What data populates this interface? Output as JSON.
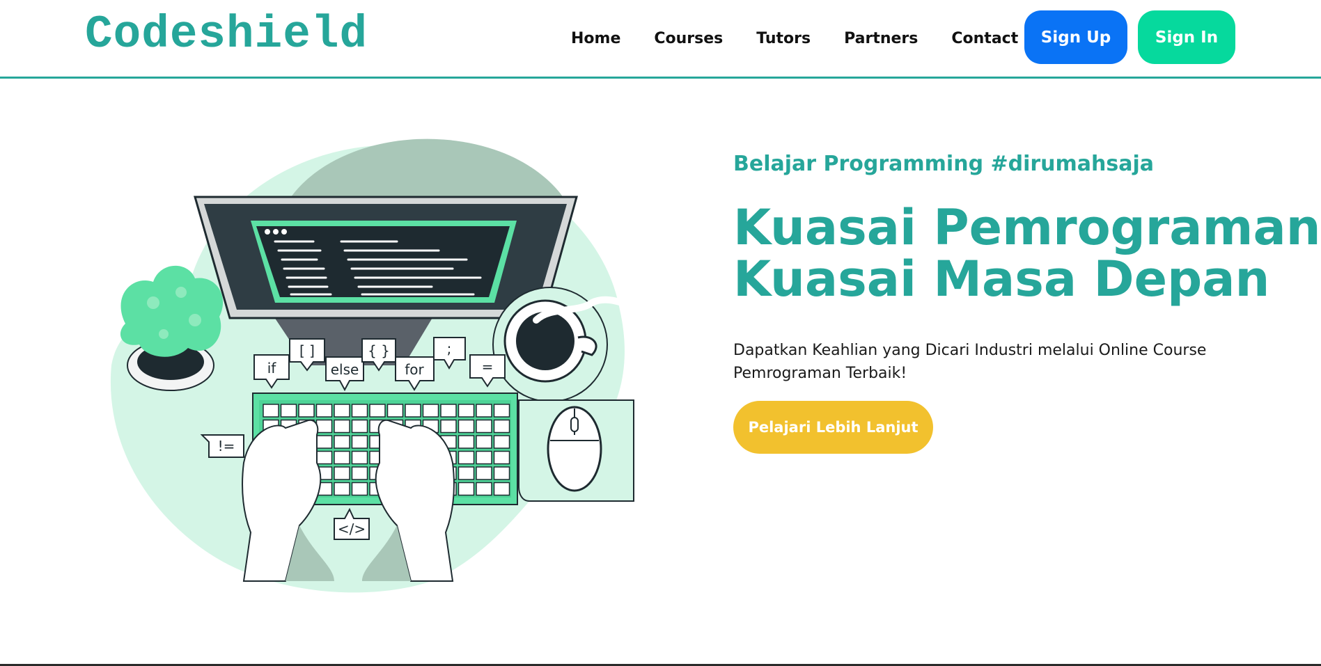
{
  "header": {
    "logo": "Codeshield",
    "nav": [
      "Home",
      "Courses",
      "Tutors",
      "Partners",
      "Contact"
    ],
    "signup_label": "Sign Up",
    "signin_label": "Sign In"
  },
  "hero": {
    "tagline": "Belajar Programming #dirumahsaja",
    "headline_line1": "Kuasai Pemrograman,",
    "headline_line2": "Kuasai Masa Depan",
    "description": "Dapatkan Keahlian yang Dicari Industri melalui Online Course Pemrograman Terbaik!",
    "cta_label": "Pelajari Lebih Lanjut",
    "illustration_bubbles": [
      "if",
      "[ ]",
      "else",
      "{ }",
      "for",
      ";",
      "=",
      "!=",
      "</>"
    ]
  },
  "colors": {
    "brand": "#26a69a",
    "signup": "#0a73f5",
    "signin": "#06d99d",
    "cta": "#f2c12e",
    "illustration_accent": "#5ce0a4",
    "illustration_light": "#d4f5e6"
  },
  "icons": [
    "computer-monitor-icon",
    "keyboard-icon",
    "mouse-icon",
    "coffee-cup-icon",
    "plant-icon",
    "typing-hands-icon"
  ]
}
